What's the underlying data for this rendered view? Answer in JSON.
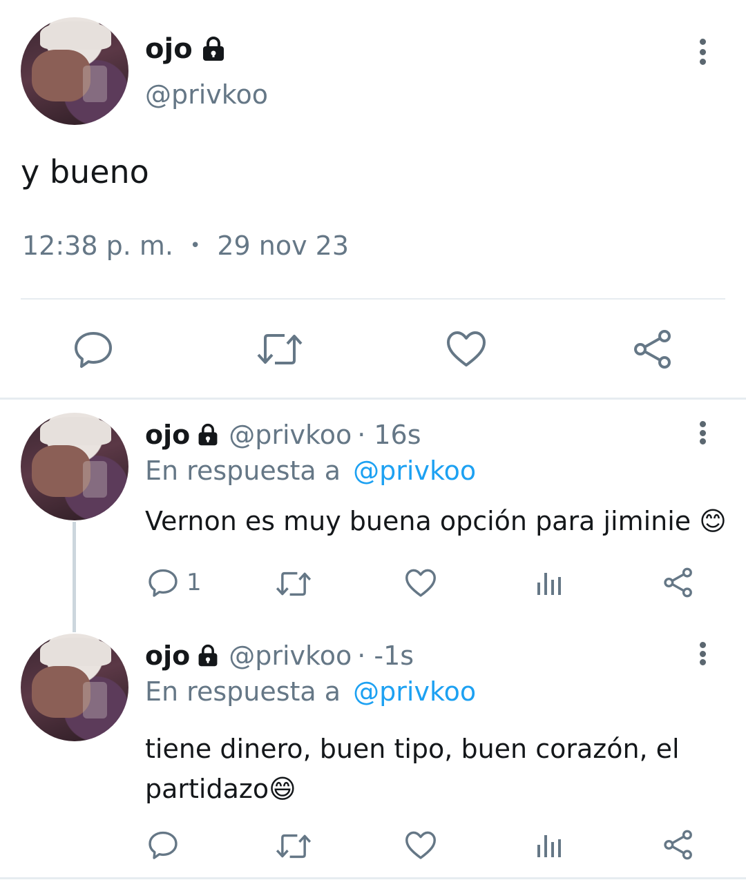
{
  "main_tweet": {
    "display_name": "ojo",
    "handle": "@privkoo",
    "text": "y bueno",
    "time": "12:38 p. m.",
    "separator": "•",
    "date": "29 nov 23"
  },
  "replies": [
    {
      "display_name": "ojo",
      "handle": "@privkoo",
      "age": "· 16s",
      "reply_prefix": "En respuesta a",
      "reply_to": "@privkoo",
      "text": "Vernon es muy buena opción para jiminie 😊",
      "reply_count": "1"
    },
    {
      "display_name": "ojo",
      "handle": "@privkoo",
      "age": "· -1s",
      "reply_prefix": "En respuesta a",
      "reply_to": "@privkoo",
      "text_line1": "tiene dinero, buen tipo, buen corazón, el",
      "text_line2": "partidazo😄",
      "reply_count": ""
    }
  ],
  "colors": {
    "muted": "#657786",
    "link": "#1da1f2",
    "divider": "#e6ecf0",
    "icon": "#5b6770"
  },
  "icons": [
    "lock-icon",
    "more-icon",
    "reply-icon",
    "retweet-icon",
    "like-icon",
    "views-icon",
    "share-icon"
  ]
}
